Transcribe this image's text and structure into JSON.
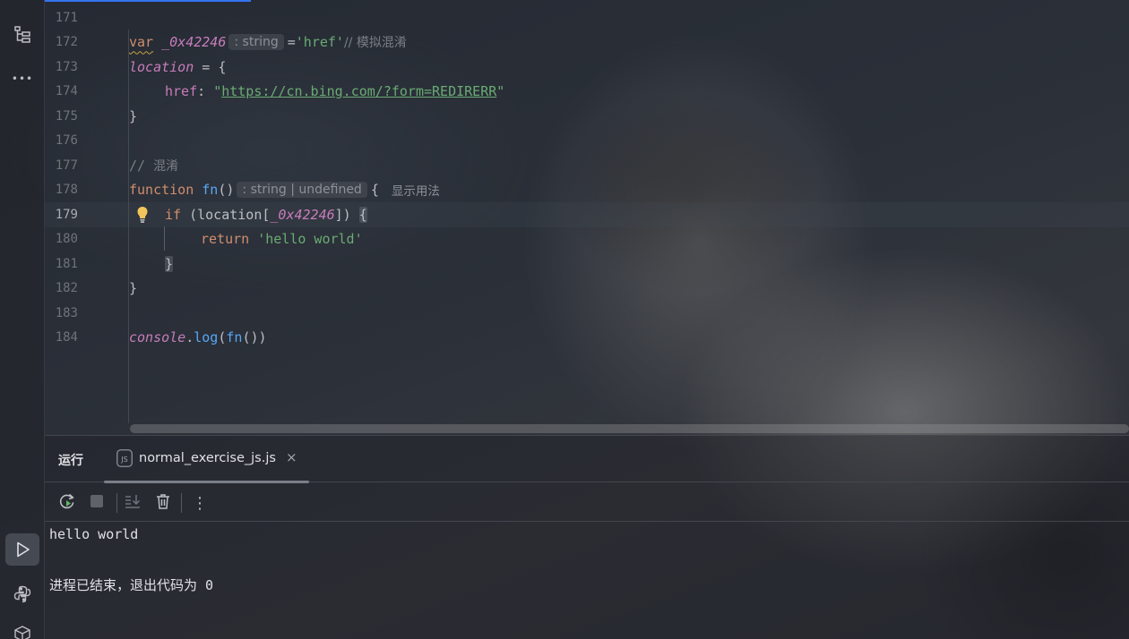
{
  "editor": {
    "lines": [
      {
        "num": "171"
      },
      {
        "num": "172",
        "tokens": [
          "var",
          "_0x42246",
          ": string",
          "=",
          "'href'",
          "// 模拟混淆"
        ]
      },
      {
        "num": "173",
        "tokens": [
          "location",
          " = {"
        ]
      },
      {
        "num": "174",
        "tokens": [
          "href",
          ": ",
          "\"",
          "https://cn.bing.com/?form=REDIRERR",
          "\""
        ]
      },
      {
        "num": "175",
        "tokens": [
          "}"
        ]
      },
      {
        "num": "176"
      },
      {
        "num": "177",
        "tokens": [
          "// ",
          "混淆"
        ]
      },
      {
        "num": "178",
        "tokens": [
          "function",
          "fn",
          "()",
          ": string | undefined",
          "{",
          "显示用法"
        ]
      },
      {
        "num": "179",
        "tokens": [
          "if",
          " (location[",
          "_0x42246",
          "]) ",
          "{"
        ]
      },
      {
        "num": "180",
        "tokens": [
          "return",
          "'hello world'"
        ]
      },
      {
        "num": "181",
        "tokens": [
          "}"
        ]
      },
      {
        "num": "182",
        "tokens": [
          "}"
        ]
      },
      {
        "num": "183"
      },
      {
        "num": "184",
        "tokens": [
          "console",
          ".",
          "log",
          "(",
          "fn",
          "())"
        ]
      }
    ]
  },
  "run_panel": {
    "title": "运行",
    "tab_label": "normal_exercise_js.js",
    "tab_close": "×",
    "tab_icon_text": "JS",
    "output": [
      "hello world",
      "进程已结束，退出代码为 0"
    ]
  },
  "toolbar": {
    "more": "⋮"
  },
  "sidebar": {
    "more": "•••"
  },
  "colors": {
    "keyword": "#cf8e6d",
    "string": "#6aab73",
    "function": "#56a8f5",
    "property": "#c77dbb",
    "comment": "#7a7e85",
    "accent": "#3574f0"
  }
}
